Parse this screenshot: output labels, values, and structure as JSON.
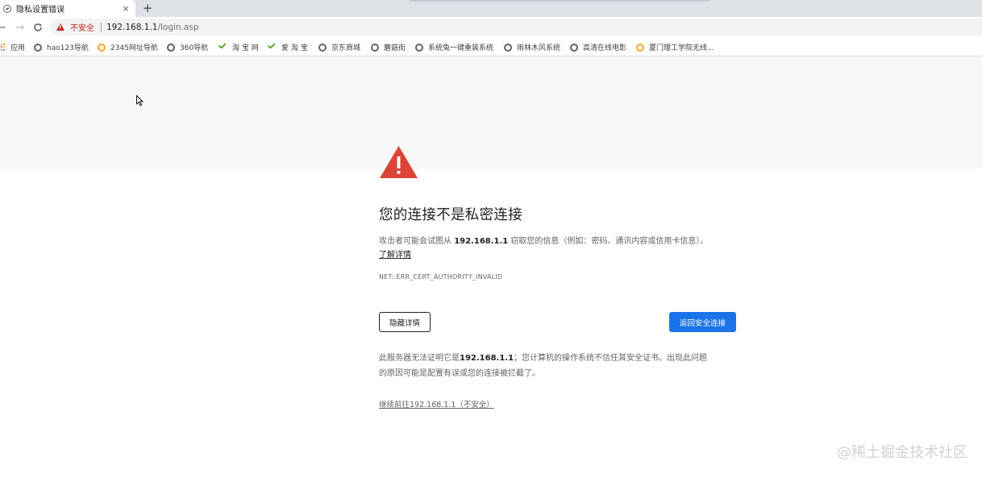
{
  "browser": {
    "tab": {
      "title": "隐私设置错误",
      "close_icon": "×"
    },
    "new_tab_icon": "+",
    "toolbar": {
      "back_icon": "←",
      "forward_icon": "→",
      "reload_icon": "C",
      "security_label": "不安全",
      "url_host": "192.168.1.1",
      "url_path": "/login.asp"
    },
    "bookmarks": [
      {
        "label": "应用",
        "icon": "apps-icon"
      },
      {
        "label": "hao123导航",
        "icon": "globe-icon"
      },
      {
        "label": "2345网址导航",
        "icon": "orange-ring-icon"
      },
      {
        "label": "360导航",
        "icon": "globe-icon"
      },
      {
        "label": "淘 宝 网",
        "icon": "check-icon"
      },
      {
        "label": "爱 淘 宝",
        "icon": "check-icon"
      },
      {
        "label": "京东商城",
        "icon": "globe-icon"
      },
      {
        "label": "蘑菇街",
        "icon": "globe-icon"
      },
      {
        "label": "系统兔一键重装系统",
        "icon": "globe-icon"
      },
      {
        "label": "雨林木风系统",
        "icon": "globe-icon"
      },
      {
        "label": "高清在线电影",
        "icon": "globe-icon"
      },
      {
        "label": "厦门理工学院无线...",
        "icon": "orange-ring-icon"
      }
    ]
  },
  "interstitial": {
    "warning_color": "#db4437",
    "heading": "您的连接不是私密连接",
    "body_prefix": "攻击者可能会试图从 ",
    "body_host": "192.168.1.1",
    "body_suffix": " 窃取您的信息（例如：密码、通讯内容或信用卡信息）。",
    "learn_more": "了解详情",
    "error_code": "NET::ERR_CERT_AUTHORITY_INVALID",
    "hide_details_button": "隐藏详情",
    "back_to_safety_button": "返回安全连接",
    "details_prefix": "此服务器无法证明它是",
    "details_host": "192.168.1.1",
    "details_line1_suffix": "；您计算机的操作系统不信任其安全证书。出现此问题",
    "details_line2": "的原因可能是配置有误或您的连接被拦截了。",
    "proceed_link": "继续前往192.168.1.1（不安全）"
  },
  "watermark": "@稀土掘金技术社区",
  "colors": {
    "primary_button": "#1a73e8",
    "danger": "#c5221f"
  }
}
